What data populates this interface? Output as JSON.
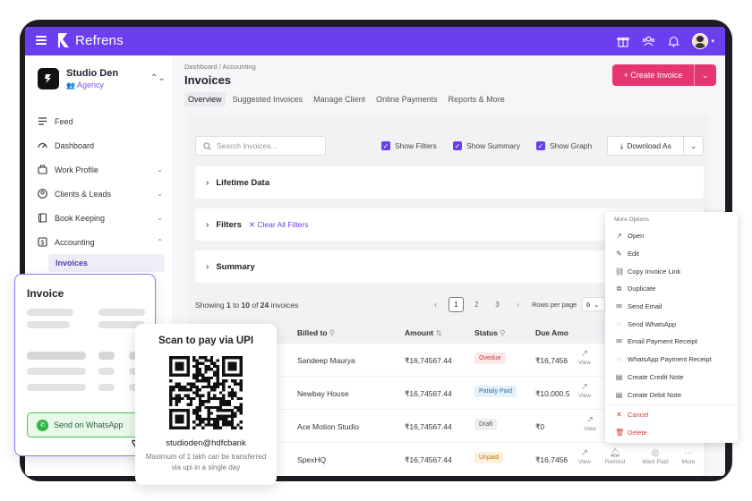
{
  "topbar": {
    "brand": "Refrens",
    "icons": [
      "gift-icon",
      "team-icon",
      "bell-icon",
      "avatar"
    ]
  },
  "sidebar": {
    "org_name": "Studio Den",
    "org_role": "Agency",
    "items": [
      {
        "label": "Feed",
        "icon": "feed-icon"
      },
      {
        "label": "Dashboard",
        "icon": "dashboard-icon"
      },
      {
        "label": "Work Profile",
        "icon": "briefcase-icon"
      },
      {
        "label": "Clients & Leads",
        "icon": "user-icon"
      },
      {
        "label": "Book Keeping",
        "icon": "book-icon"
      },
      {
        "label": "Accounting",
        "icon": "accounting-icon"
      }
    ],
    "active_sub": "Invoices"
  },
  "header": {
    "breadcrumb": "Dashboard / Accounting",
    "title": "Invoices",
    "create_label": "+ Create Invoice",
    "tabs": [
      "Overview",
      "Suggested Invoices",
      "Manage Client",
      "Online Payments",
      "Reports & More"
    ]
  },
  "toolbar": {
    "search_placeholder": "Search Invoices...",
    "show_filters": "Show Filters",
    "show_summary": "Show Summary",
    "show_graph": "Show Graph",
    "download_label": "Download As"
  },
  "accordions": {
    "lifetime": "Lifetime Data",
    "filters": "Filters",
    "clear_filters": "Clear All Filters",
    "summary": "Summary"
  },
  "pagination": {
    "showing_prefix": "Showing ",
    "from": "1",
    "to_word": " to ",
    "to": "10",
    "of_word": " of ",
    "total": "24",
    "suffix": " invoices",
    "pages": [
      "1",
      "2",
      "3"
    ],
    "rows_label": "Rows per page",
    "rows_value": "6"
  },
  "table": {
    "headers": [
      "Billed to",
      "Amount",
      "Status",
      "Due Amo"
    ],
    "rows": [
      {
        "billed_to": "Sandeep  Maurya",
        "amount": "₹16,74567.44",
        "status": "Ovedue",
        "due": "₹16,7456"
      },
      {
        "billed_to": "Newbay House",
        "amount": "₹16,74567.44",
        "status": "Patialy Paid",
        "due": "₹10,000.5"
      },
      {
        "billed_to": "Ace Motion Studio",
        "amount": "₹16,74567.44",
        "status": "Draft",
        "due": "₹0"
      },
      {
        "billed_to": "SpexHQ",
        "amount": "₹16,74567.44",
        "status": "Unpaid",
        "due": "₹16,7456"
      }
    ],
    "row_actions": {
      "view": "View",
      "remind": "Remind",
      "mark_paid": "Mark Paid",
      "more": "More"
    }
  },
  "menu": {
    "title": "More Options",
    "items": [
      {
        "label": "Open",
        "icon": "external-link-icon"
      },
      {
        "label": "Edit",
        "icon": "pencil-icon"
      },
      {
        "label": "Copy Invoice Link",
        "icon": "link-icon"
      },
      {
        "label": "Duplicate",
        "icon": "copy-icon"
      },
      {
        "label": "Send Email",
        "icon": "mail-icon"
      },
      {
        "label": "Send WhatsApp",
        "icon": "whatsapp-icon"
      },
      {
        "label": "Email Payment Receipt",
        "icon": "mail-icon"
      },
      {
        "label": "WhatsApp Payment Receipt",
        "icon": "whatsapp-icon"
      },
      {
        "label": "Create Credit Note",
        "icon": "document-icon"
      },
      {
        "label": "Create Debit Note",
        "icon": "document-icon"
      }
    ],
    "danger_items": [
      {
        "label": "Cancel",
        "icon": "close-icon"
      },
      {
        "label": "Delete",
        "icon": "trash-icon"
      }
    ]
  },
  "invoice_card": {
    "title": "Invoice",
    "whatsapp_label": "Send on WhatsApp"
  },
  "upi_card": {
    "title": "Scan to pay via UPI",
    "upi_id": "studioden@hdfcbank",
    "note": "Maximum of 1 lakh can be transferred via upi in a single day"
  },
  "colors": {
    "brand": "#6b3ef0",
    "create": "#e6356f",
    "whatsapp": "#2bb741"
  }
}
